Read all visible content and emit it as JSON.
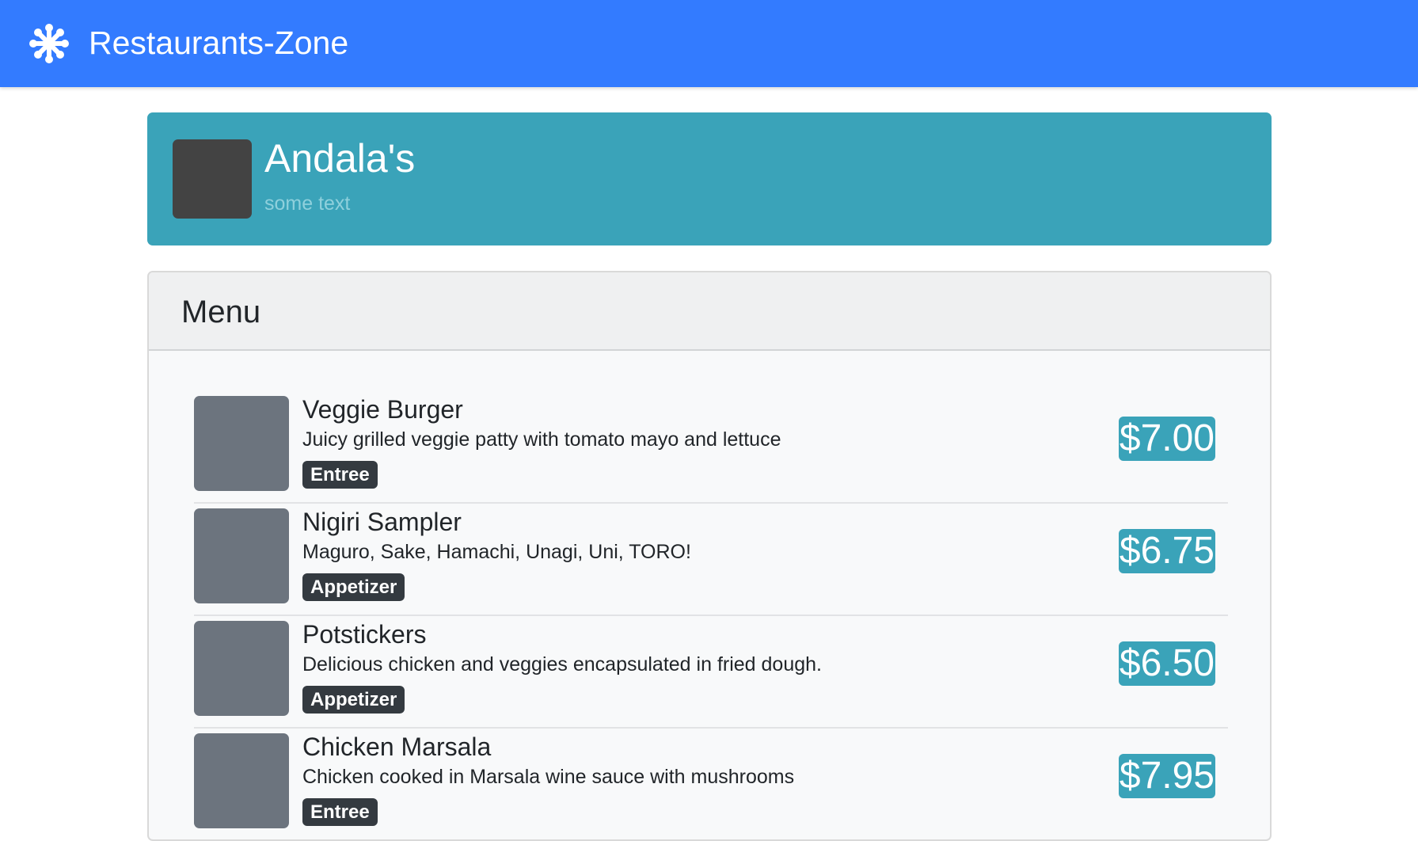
{
  "navbar": {
    "brand_icon": "asterisk-icon",
    "title": "Restaurants-Zone",
    "background": "#337bff"
  },
  "restaurant": {
    "name": "Andala's",
    "subtitle": "some text",
    "banner_color": "#3aa3b9"
  },
  "menu": {
    "title": "Menu",
    "items": [
      {
        "name": "Veggie Burger",
        "description": "Juicy grilled veggie patty with tomato mayo and lettuce",
        "category": "Entree",
        "price": "$7.00"
      },
      {
        "name": "Nigiri Sampler",
        "description": "Maguro, Sake, Hamachi, Unagi, Uni, TORO!",
        "category": "Appetizer",
        "price": "$6.75"
      },
      {
        "name": "Potstickers",
        "description": "Delicious chicken and veggies encapsulated in fried dough.",
        "category": "Appetizer",
        "price": "$6.50"
      },
      {
        "name": "Chicken Marsala",
        "description": "Chicken cooked in Marsala wine sauce with mushrooms",
        "category": "Entree",
        "price": "$7.95"
      }
    ]
  }
}
